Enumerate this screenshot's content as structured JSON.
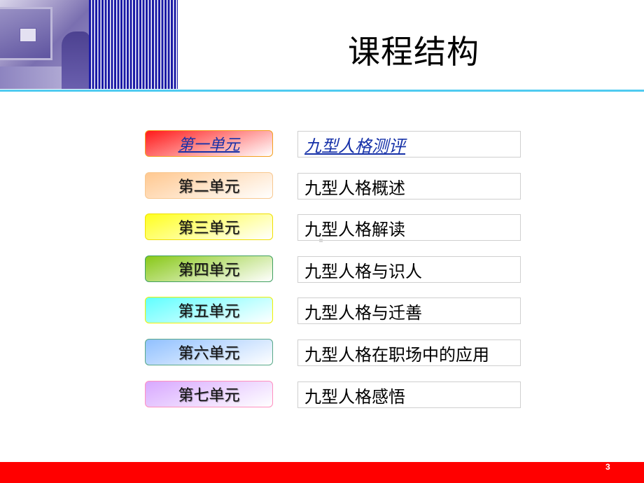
{
  "slide": {
    "title": "课程结构",
    "page_number": "3",
    "colors": {
      "header_stripes": "#1a1aa6",
      "header_rule": "#4fcbf0",
      "footer_bar": "#ff0000",
      "link_text": "#1530a8"
    }
  },
  "units": [
    {
      "label": "第一单元",
      "topic": "九型人格测评",
      "active": true,
      "gradient_from": "#ff1a1a",
      "gradient_to": "#ffffff",
      "border": "#f4a020"
    },
    {
      "label": "第二单元",
      "topic": "九型人格概述",
      "active": false,
      "gradient_from": "#ffc890",
      "gradient_to": "#ffffff",
      "border": "#f8c890"
    },
    {
      "label": "第三单元",
      "topic": "九型人格解读",
      "active": false,
      "gradient_from": "#ffff20",
      "gradient_to": "#ffffff",
      "border": "#f0e000"
    },
    {
      "label": "第四单元",
      "topic": "九型人格与识人",
      "active": false,
      "gradient_from": "#88c818",
      "gradient_to": "#ffffff",
      "border": "#40a060"
    },
    {
      "label": "第五单元",
      "topic": "九型人格与迁善",
      "active": false,
      "gradient_from": "#60ffff",
      "gradient_to": "#ffffff",
      "border": "#f0f000"
    },
    {
      "label": "第六单元",
      "topic": "九型人格在职场中的应用",
      "active": false,
      "gradient_from": "#90c0ff",
      "gradient_to": "#ffffff",
      "border": "#58a888"
    },
    {
      "label": "第七单元",
      "topic": "九型人格感悟",
      "active": false,
      "gradient_from": "#d8a8ff",
      "gradient_to": "#ffffff",
      "border": "#ff90c0"
    }
  ]
}
